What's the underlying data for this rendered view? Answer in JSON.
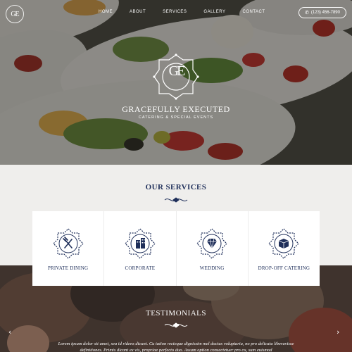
{
  "brand": {
    "monogram": "GE",
    "name": "GRACEFULLY EXECUTED",
    "tagline": "CATERING & SPECIAL EVENTS"
  },
  "nav": {
    "items": [
      {
        "label": "HOME"
      },
      {
        "label": "ABOUT"
      },
      {
        "label": "SERVICES"
      },
      {
        "label": "GALLERY"
      },
      {
        "label": "CONTACT"
      }
    ],
    "phone": "(123) 456-7890"
  },
  "services": {
    "title": "OUR SERVICES",
    "items": [
      {
        "label": "PRIVATE DINING",
        "icon": "fork-knife-icon"
      },
      {
        "label": "CORPORATE",
        "icon": "building-icon"
      },
      {
        "label": "WEDDING",
        "icon": "diamond-icon"
      },
      {
        "label": "DROP-OFF CATERING",
        "icon": "box-icon"
      }
    ]
  },
  "testimonials": {
    "title": "TESTIMONIALS",
    "text": "Lorem ipsum dolor sit amet, sea id ridens dicunt. Cu tation recteque dignissim mel doctus voluptaria, no pro delicata liberavisse definitiones. Primis dicant ex vis, propriae perfecto duo. Assum option consectetuer pro cu, sum euismod"
  },
  "colors": {
    "navy": "#1f2f5a",
    "background": "#efeeec",
    "card": "#ffffff"
  }
}
